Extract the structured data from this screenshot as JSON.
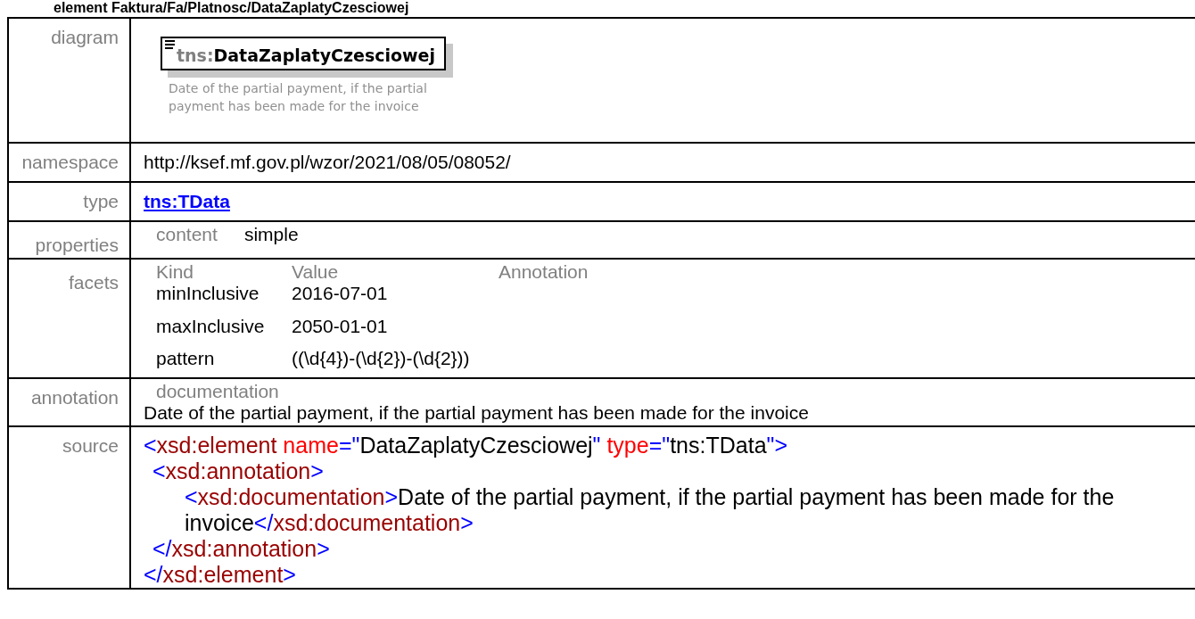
{
  "title": "element Faktura/Fa/Platnosc/DataZaplatyCzesciowej",
  "rows": [
    {
      "kind": "diagram",
      "label": "diagram",
      "prefix": "tns:",
      "name": "DataZaplatyCzesciowej",
      "caption": "Date of the partial payment, if the partial payment has been made for the invoice"
    },
    {
      "kind": "text",
      "label": "namespace",
      "value": "http://ksef.mf.gov.pl/wzor/2021/08/05/08052/"
    },
    {
      "kind": "link",
      "label": "type",
      "value": "tns:TData"
    },
    {
      "kind": "properties",
      "label": "properties",
      "items": [
        {
          "key": "content",
          "value": "simple"
        }
      ]
    },
    {
      "kind": "facets",
      "label": "facets",
      "columns": [
        "Kind",
        "Value",
        "Annotation"
      ],
      "items": [
        {
          "kind": "minInclusive",
          "value": "2016-07-01"
        },
        {
          "kind": "maxInclusive",
          "value": "2050-01-01"
        },
        {
          "kind": "pattern",
          "value": "((\\d{4})-(\\d{2})-(\\d{2}))"
        }
      ]
    },
    {
      "kind": "annotation",
      "label": "annotation",
      "heading": "documentation",
      "value": "Date of the partial payment, if the partial payment has been made for the invoice"
    },
    {
      "kind": "source",
      "label": "source",
      "lines": [
        {
          "open": [
            {
              "kind": "punct",
              "text": "<"
            },
            {
              "kind": "tag",
              "text": "xsd:element"
            },
            {
              "kind": "attr",
              "text": " name"
            },
            {
              "kind": "punct",
              "text": "=\""
            },
            {
              "kind": "text",
              "text": "DataZaplatyCzesciowej"
            },
            {
              "kind": "punct",
              "text": "\""
            },
            {
              "kind": "attr",
              "text": " type"
            },
            {
              "kind": "punct",
              "text": "=\""
            },
            {
              "kind": "text",
              "text": "tns:TData"
            },
            {
              "kind": "punct",
              "text": "\">"
            }
          ],
          "children": [
            {
              "open": [
                {
                  "kind": "punct",
                  "text": "<"
                },
                {
                  "kind": "tag",
                  "text": "xsd:annotation"
                },
                {
                  "kind": "punct",
                  "text": ">"
                }
              ],
              "children": [
                {
                  "open": [
                    {
                      "kind": "punct",
                      "text": "<"
                    },
                    {
                      "kind": "tag",
                      "text": "xsd:documentation"
                    },
                    {
                      "kind": "punct",
                      "text": ">"
                    },
                    {
                      "kind": "text",
                      "text": "Date of the partial payment, if the partial payment has been made for the invoice"
                    },
                    {
                      "kind": "punct",
                      "text": "</"
                    },
                    {
                      "kind": "tag",
                      "text": "xsd:documentation"
                    },
                    {
                      "kind": "punct",
                      "text": ">"
                    }
                  ]
                }
              ],
              "close": [
                {
                  "kind": "punct",
                  "text": "</"
                },
                {
                  "kind": "tag",
                  "text": "xsd:annotation"
                },
                {
                  "kind": "punct",
                  "text": ">"
                }
              ]
            }
          ],
          "close": [
            {
              "kind": "punct",
              "text": "</"
            },
            {
              "kind": "tag",
              "text": "xsd:element"
            },
            {
              "kind": "punct",
              "text": ">"
            }
          ]
        }
      ]
    }
  ]
}
